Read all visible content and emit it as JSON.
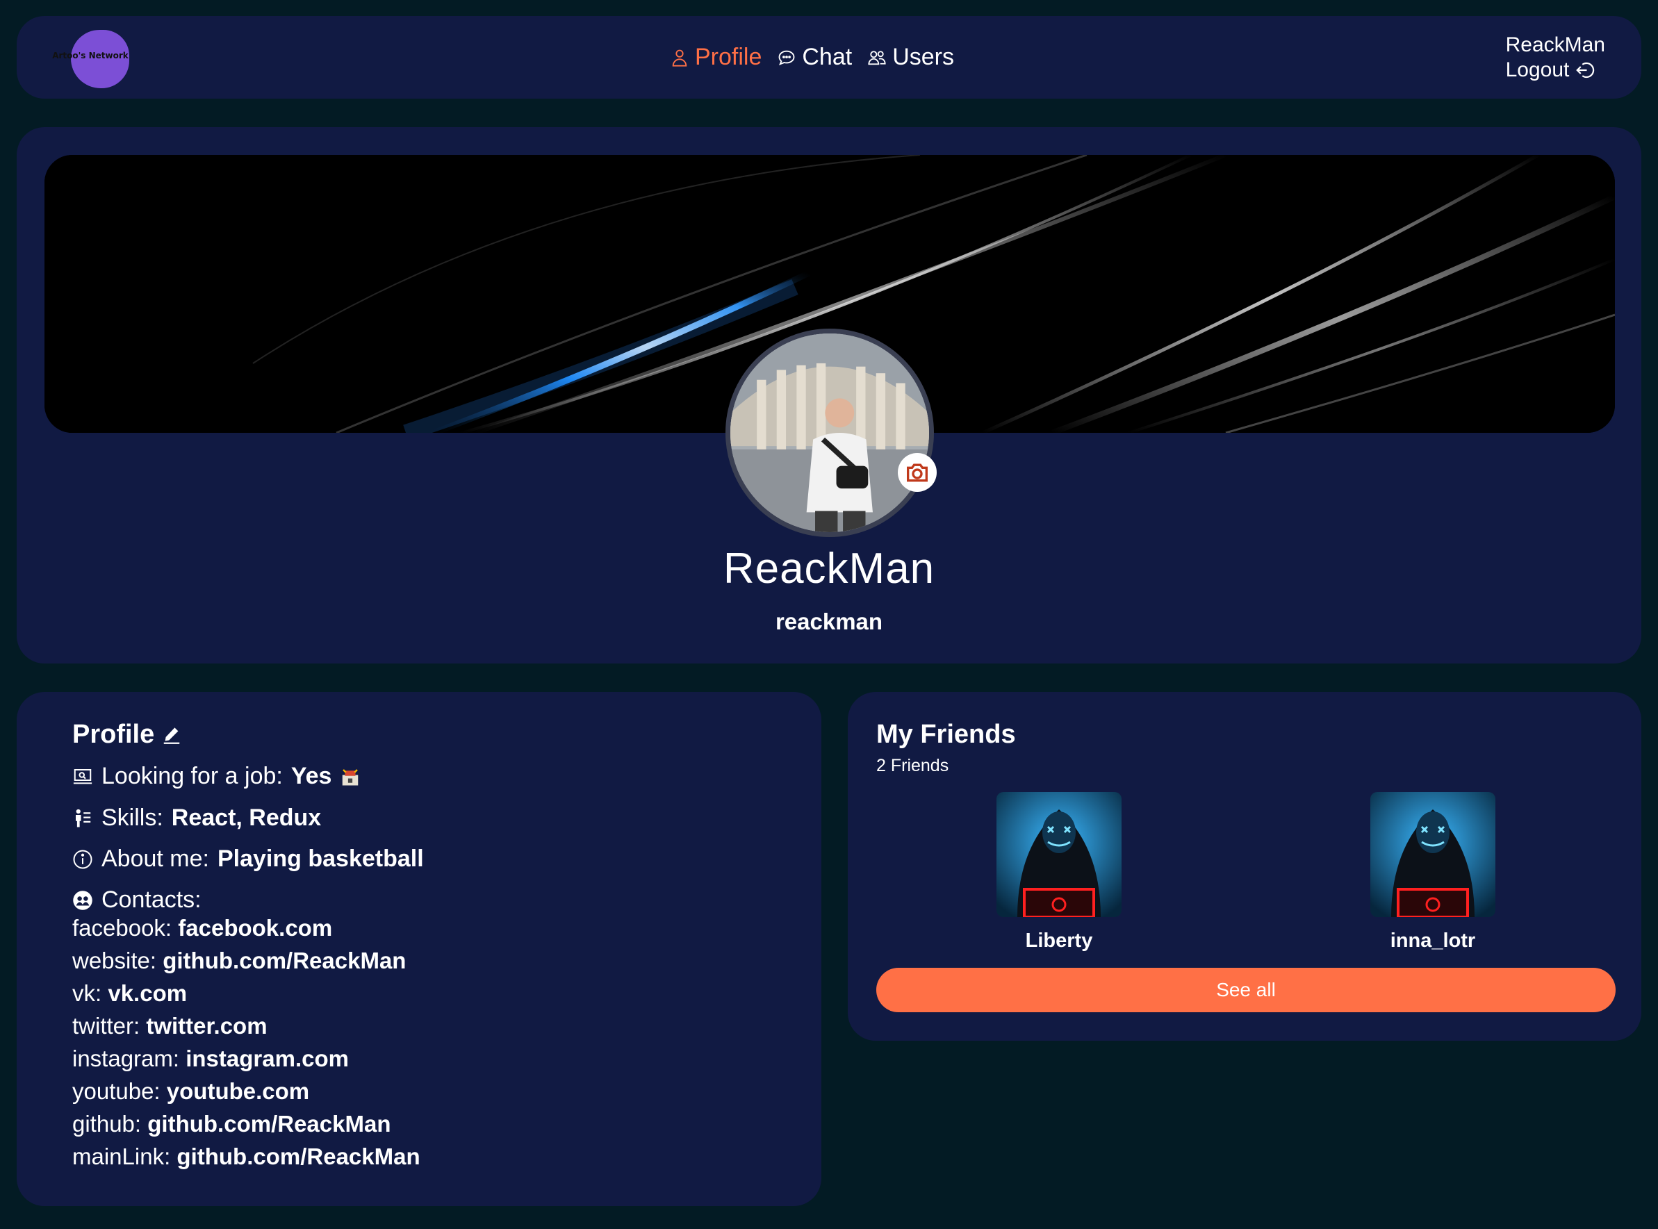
{
  "header": {
    "logo_text": "Artoo's Network",
    "nav": [
      {
        "label": "Profile",
        "icon": "user-icon",
        "active": true
      },
      {
        "label": "Chat",
        "icon": "chat-bubble-icon",
        "active": false
      },
      {
        "label": "Users",
        "icon": "users-icon",
        "active": false
      }
    ],
    "current_user": "ReackMan",
    "logout_label": "Logout"
  },
  "profile_header": {
    "display_name": "ReackMan",
    "username": "reackman"
  },
  "profile_info": {
    "title": "Profile",
    "looking_for_job_label": "Looking for a job:",
    "looking_for_job_value": "Yes",
    "skills_label": "Skills:",
    "skills_value": "React, Redux",
    "about_label": "About me:",
    "about_value": "Playing basketball",
    "contacts_label": "Contacts:",
    "contacts": [
      {
        "key": "facebook:",
        "value": "facebook.com"
      },
      {
        "key": "website:",
        "value": "github.com/ReackMan"
      },
      {
        "key": "vk:",
        "value": "vk.com"
      },
      {
        "key": "twitter:",
        "value": "twitter.com"
      },
      {
        "key": "instagram:",
        "value": "instagram.com"
      },
      {
        "key": "youtube:",
        "value": "youtube.com"
      },
      {
        "key": "github:",
        "value": "github.com/ReackMan"
      },
      {
        "key": "mainLink:",
        "value": "github.com/ReackMan"
      }
    ]
  },
  "friends": {
    "title": "My Friends",
    "count_label": "2 Friends",
    "list": [
      {
        "name": "Liberty"
      },
      {
        "name": "inna_lotr"
      }
    ],
    "see_all_label": "See all"
  },
  "colors": {
    "background": "#031b24",
    "card": "#111a43",
    "accent": "#ff7046",
    "logo": "#7c4fd6"
  }
}
